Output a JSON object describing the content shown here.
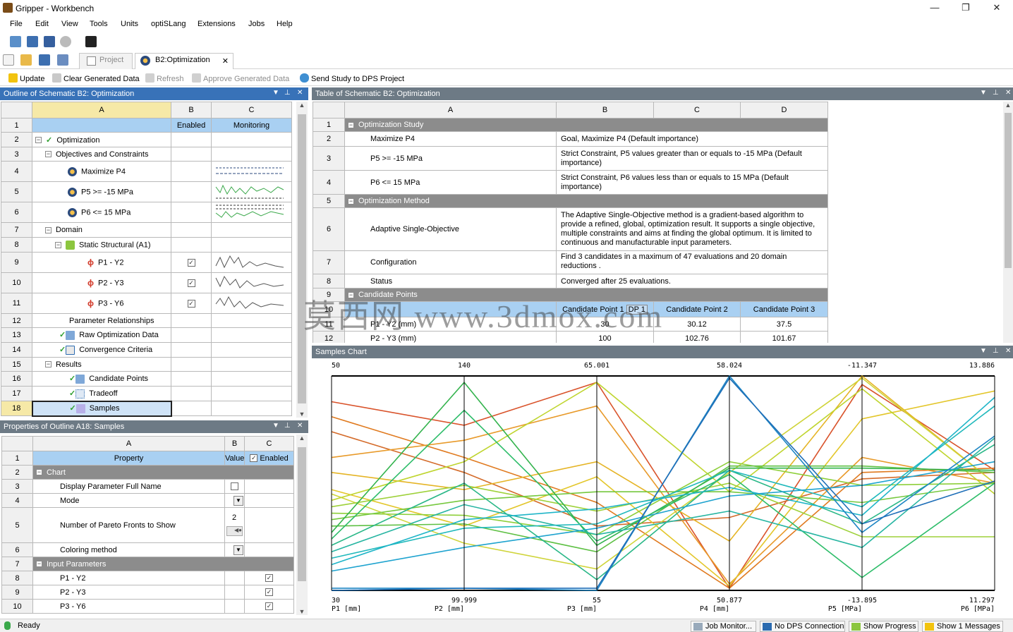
{
  "window": {
    "title": "Gripper - Workbench",
    "min": "—",
    "max": "❐",
    "close": "✕"
  },
  "menu": [
    "File",
    "Edit",
    "View",
    "Tools",
    "Units",
    "optiSLang",
    "Extensions",
    "Jobs",
    "Help"
  ],
  "tabs": [
    {
      "label": "Project"
    },
    {
      "label": "B2:Optimization",
      "close": "✕"
    }
  ],
  "toolbar": {
    "update": "Update",
    "clear": "Clear Generated Data",
    "refresh": "Refresh",
    "approve": "Approve Generated Data",
    "send": "Send Study to DPS Project"
  },
  "outline": {
    "title": "Outline of Schematic B2: Optimization",
    "cols": [
      "A",
      "B",
      "C"
    ],
    "row1": {
      "b": "Enabled",
      "c": "Monitoring"
    },
    "rows": [
      {
        "n": "1"
      },
      {
        "n": "2",
        "label": "Optimization"
      },
      {
        "n": "3",
        "label": "Objectives and Constraints"
      },
      {
        "n": "4",
        "label": "Maximize P4"
      },
      {
        "n": "5",
        "label": "P5 >= -15 MPa"
      },
      {
        "n": "6",
        "label": "P6 <= 15 MPa"
      },
      {
        "n": "7",
        "label": "Domain"
      },
      {
        "n": "8",
        "label": "Static Structural (A1)"
      },
      {
        "n": "9",
        "label": "P1 - Y2"
      },
      {
        "n": "10",
        "label": "P2 - Y3"
      },
      {
        "n": "11",
        "label": "P3 - Y6"
      },
      {
        "n": "12",
        "label": "Parameter Relationships"
      },
      {
        "n": "13",
        "label": "Raw Optimization Data"
      },
      {
        "n": "14",
        "label": "Convergence Criteria"
      },
      {
        "n": "15",
        "label": "Results"
      },
      {
        "n": "16",
        "label": "Candidate Points"
      },
      {
        "n": "17",
        "label": "Tradeoff"
      },
      {
        "n": "18",
        "label": "Samples"
      }
    ]
  },
  "properties": {
    "title": "Properties of Outline A18: Samples",
    "cols": [
      "A",
      "B",
      "C"
    ],
    "row1": {
      "a": "Property",
      "b": "Value",
      "c": "Enabled"
    },
    "rows": [
      {
        "n": "1"
      },
      {
        "n": "2",
        "label": "Chart"
      },
      {
        "n": "3",
        "label": "Display Parameter Full Name"
      },
      {
        "n": "4",
        "label": "Mode"
      },
      {
        "n": "5",
        "label": "Number of Pareto Fronts to Show",
        "value": "2"
      },
      {
        "n": "6",
        "label": "Coloring method"
      },
      {
        "n": "7",
        "label": "Input Parameters"
      },
      {
        "n": "8",
        "label": "P1 - Y2"
      },
      {
        "n": "9",
        "label": "P2 - Y3"
      },
      {
        "n": "10",
        "label": "P3 - Y6"
      }
    ]
  },
  "table": {
    "title": "Table of Schematic B2: Optimization",
    "cols": [
      "A",
      "B",
      "C",
      "D"
    ],
    "rows": [
      {
        "n": "1",
        "a": "Optimization Study"
      },
      {
        "n": "2",
        "a": "Maximize P4",
        "b": "Goal, Maximize P4 (Default importance)"
      },
      {
        "n": "3",
        "a": "P5 >= -15 MPa",
        "b": "Strict Constraint, P5 values greater than or equals to -15 MPa (Default importance)"
      },
      {
        "n": "4",
        "a": "P6 <= 15 MPa",
        "b": "Strict Constraint, P6 values less than or equals to 15 MPa (Default importance)"
      },
      {
        "n": "5",
        "a": "Optimization Method"
      },
      {
        "n": "6",
        "a": "Adaptive Single-Objective",
        "b": "The Adaptive Single-Objective method is a gradient-based algorithm to provide a refined, global, optimization result. It supports a single objective, multiple constraints and aims at finding the global optimum. It is limited to continuous and manufacturable input parameters."
      },
      {
        "n": "7",
        "a": "Configuration",
        "b": "Find 3 candidates in a maximum of 47 evaluations and 20 domain reductions ."
      },
      {
        "n": "8",
        "a": "Status",
        "b": "Converged after 25 evaluations."
      },
      {
        "n": "9",
        "a": "Candidate Points"
      },
      {
        "n": "10",
        "b": "Candidate Point 1",
        "bdp": "DP 1",
        "c": "Candidate Point 2",
        "d": "Candidate Point 3"
      },
      {
        "n": "11",
        "a": "P1 - Y2 (mm)",
        "b": "30",
        "c": "30.12",
        "d": "37.5"
      },
      {
        "n": "12",
        "a": "P2 - Y3 (mm)",
        "b": "100",
        "c": "102.76",
        "d": "101.67"
      }
    ]
  },
  "chart": {
    "title": "Samples Chart"
  },
  "chart_data": {
    "type": "parallel-coordinates",
    "axes": [
      {
        "label": "P1 [mm]",
        "max": "50",
        "min": "30"
      },
      {
        "label": "P2 [mm]",
        "max": "140",
        "min": "99.999"
      },
      {
        "label": "P3 [mm]",
        "max": "65.001",
        "min": "55"
      },
      {
        "label": "P4 [mm]",
        "max": "58.024",
        "min": "50.877"
      },
      {
        "label": "P5 [MPa]",
        "max": "-11.347",
        "min": "-13.895"
      },
      {
        "label": "P6 [MPa]",
        "max": "13.886",
        "min": "11.297"
      }
    ],
    "lines": [
      {
        "color": "#d9532b",
        "v": [
          0.88,
          0.77,
          0.97,
          0.01,
          0.96,
          0.56
        ]
      },
      {
        "color": "#e07a1f",
        "v": [
          0.81,
          0.62,
          0.41,
          0.01,
          0.55,
          0.57
        ]
      },
      {
        "color": "#d46b2a",
        "v": [
          0.74,
          0.55,
          0.3,
          0.34,
          0.52,
          0.55
        ]
      },
      {
        "color": "#e89a2a",
        "v": [
          0.62,
          0.7,
          0.86,
          0.03,
          0.62,
          0.5
        ]
      },
      {
        "color": "#e5b425",
        "v": [
          0.55,
          0.47,
          0.6,
          0.23,
          1.0,
          0.5
        ]
      },
      {
        "color": "#e3c62a",
        "v": [
          0.47,
          0.3,
          0.53,
          0.02,
          0.8,
          0.93
        ]
      },
      {
        "color": "#cfd43a",
        "v": [
          0.45,
          0.22,
          0.1,
          0.55,
          0.99,
          0.5
        ]
      },
      {
        "color": "#bfd52f",
        "v": [
          0.42,
          0.6,
          0.97,
          0.46,
          0.94,
          0.45
        ]
      },
      {
        "color": "#9ed13a",
        "v": [
          0.39,
          0.49,
          0.37,
          0.5,
          0.25,
          0.25
        ]
      },
      {
        "color": "#8ecf3a",
        "v": [
          0.36,
          0.35,
          0.26,
          0.6,
          0.49,
          0.5
        ]
      },
      {
        "color": "#76c83e",
        "v": [
          0.33,
          0.42,
          0.46,
          0.46,
          0.41,
          0.5
        ]
      },
      {
        "color": "#5ec044",
        "v": [
          0.3,
          0.31,
          0.18,
          0.58,
          0.58,
          0.55
        ]
      },
      {
        "color": "#33b34d",
        "v": [
          0.27,
          0.97,
          0.21,
          0.57,
          0.57,
          0.56
        ]
      },
      {
        "color": "#2ebd6a",
        "v": [
          0.24,
          0.84,
          0.23,
          0.54,
          0.06,
          0.5
        ]
      },
      {
        "color": "#29b787",
        "v": [
          0.21,
          0.5,
          0.05,
          0.56,
          0.31,
          0.68
        ]
      },
      {
        "color": "#27b5a2",
        "v": [
          0.18,
          0.4,
          0.26,
          0.37,
          0.2,
          0.71
        ]
      },
      {
        "color": "#21b9bc",
        "v": [
          0.15,
          0.29,
          0.31,
          0.56,
          0.39,
          0.86
        ]
      },
      {
        "color": "#1fb5c8",
        "v": [
          0.12,
          0.33,
          0.38,
          0.48,
          0.35,
          0.9
        ]
      },
      {
        "color": "#1ea3cf",
        "v": [
          0.09,
          0.2,
          0.29,
          0.44,
          0.49,
          0.6
        ]
      },
      {
        "color": "#1e86c4",
        "v": [
          0.01,
          0.01,
          0.0,
          1.0,
          0.27,
          0.72
        ]
      },
      {
        "color": "#1f6fb8",
        "v": [
          0.0,
          0.01,
          0.01,
          0.99,
          0.31,
          0.51
        ]
      }
    ]
  },
  "status": {
    "ready": "Ready",
    "job": "Job Monitor...",
    "dps": "No DPS Connection",
    "progress": "Show Progress",
    "messages": "Show 1 Messages"
  },
  "watermark": "莫西网 www.3dmox.com"
}
